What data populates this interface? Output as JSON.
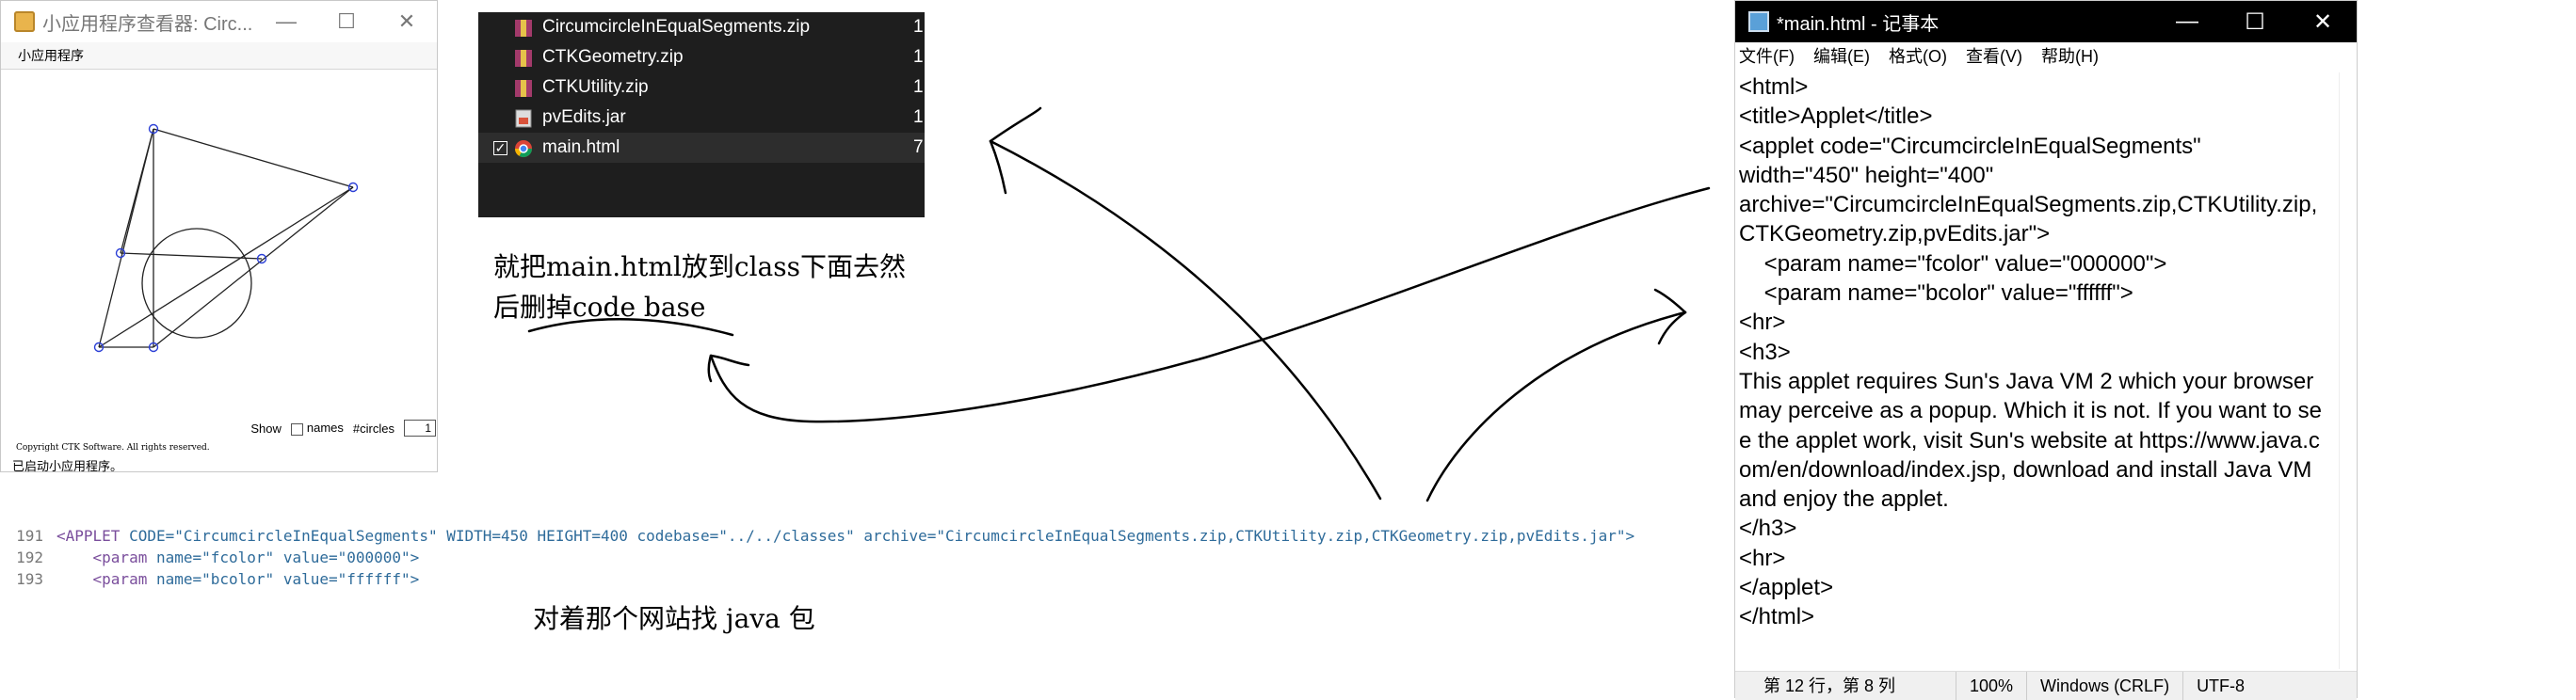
{
  "applet_viewer": {
    "title": "小应用程序查看器: Circ...",
    "menu": "小应用程序",
    "controls": {
      "show_label": "Show",
      "names_label": "names",
      "circles_label": "#circles",
      "circles_value": "1"
    },
    "copyright": "Copyright CTK Software. All rights reserved.",
    "status": "已启动小应用程序。"
  },
  "file_list": [
    {
      "name": "CircumcircleInEqualSegments.zip",
      "size": "1,",
      "type": "zip"
    },
    {
      "name": "CTKGeometry.zip",
      "size": "1,",
      "type": "zip"
    },
    {
      "name": "CTKUtility.zip",
      "size": "1,",
      "type": "zip"
    },
    {
      "name": "pvEdits.jar",
      "size": "1,",
      "type": "jar"
    },
    {
      "name": "main.html",
      "size": "7,",
      "type": "html",
      "checked": true
    }
  ],
  "notes": {
    "line1": "就把main.html放到class下面去然",
    "line2": "后删掉code base",
    "bottom": "对着那个网站找 java 包"
  },
  "code_snippet": {
    "lines": [
      {
        "num": "191",
        "tag": "<APPLET",
        "rest": " CODE=\"CircumcircleInEqualSegments\" WIDTH=450 HEIGHT=400 codebase=\"../../classes\" archive=\"CircumcircleInEqualSegments.zip,CTKUtility.zip,CTKGeometry.zip,pvEdits.jar\">"
      },
      {
        "num": "192",
        "tag": "    <param",
        "rest": " name=\"fcolor\" value=\"000000\">"
      },
      {
        "num": "193",
        "tag": "    <param",
        "rest": " name=\"bcolor\" value=\"ffffff\">"
      }
    ]
  },
  "notepad": {
    "title": "*main.html - 记事本",
    "menu": [
      "文件(F)",
      "编辑(E)",
      "格式(O)",
      "查看(V)",
      "帮助(H)"
    ],
    "content": "<html>\n<title>Applet</title>\n<applet code=\"CircumcircleInEqualSegments\"\nwidth=\"450\" height=\"400\"\narchive=\"CircumcircleInEqualSegments.zip,CTKUtility.zip,CTKGeometry.zip,pvEdits.jar\">\n    <param name=\"fcolor\" value=\"000000\">\n    <param name=\"bcolor\" value=\"ffffff\">\n<hr>\n<h3>\nThis applet requires Sun's Java VM 2 which your browser may perceive as a popup. Which it is not. If you want to see the applet work, visit Sun's website at https://www.java.com/en/download/index.jsp, download and install Java VM and enjoy the applet.\n</h3>\n<hr>\n</applet>\n</html>",
    "status": {
      "position": "第 12 行，第 8 列",
      "zoom": "100%",
      "eol": "Windows (CRLF)",
      "encoding": "UTF-8"
    }
  }
}
